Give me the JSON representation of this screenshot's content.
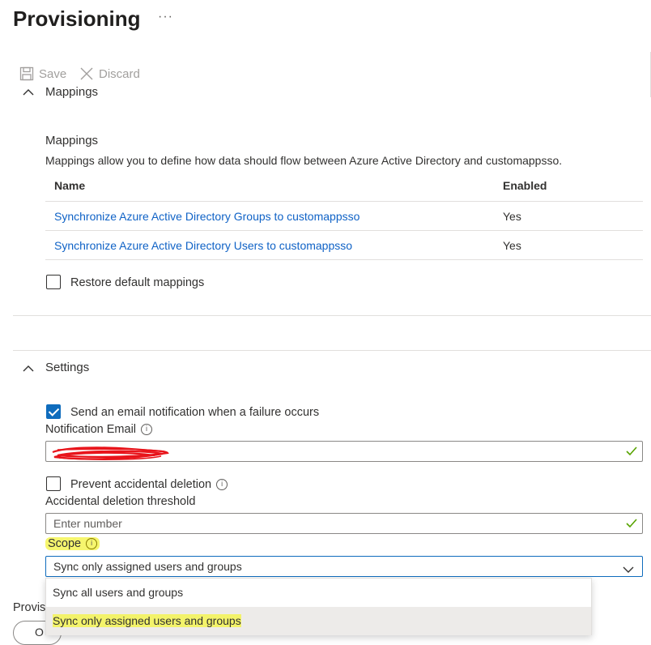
{
  "page": {
    "title": "Provisioning",
    "more": "···"
  },
  "toolbar": {
    "save_label": "Save",
    "discard_label": "Discard"
  },
  "mappings_section": {
    "header": "Mappings",
    "title": "Mappings",
    "description": "Mappings allow you to define how data should flow between Azure Active Directory and customappsso.",
    "columns": [
      "Name",
      "Enabled"
    ],
    "rows": [
      {
        "name": "Synchronize Azure Active Directory Groups to customappsso",
        "enabled": "Yes"
      },
      {
        "name": "Synchronize Azure Active Directory Users to customappsso",
        "enabled": "Yes"
      }
    ],
    "restore_label": "Restore default mappings"
  },
  "settings_section": {
    "header": "Settings",
    "email_notification_label": "Send an email notification when a failure occurs",
    "email_notification_checked": true,
    "notification_email_label": "Notification Email",
    "prevent_deletion_label": "Prevent accidental deletion",
    "prevent_deletion_checked": false,
    "threshold_label": "Accidental deletion threshold",
    "threshold_placeholder": "Enter number",
    "scope_label": "Scope",
    "scope_value": "Sync only assigned users and groups",
    "scope_options": [
      "Sync all users and groups",
      "Sync only assigned users and groups"
    ]
  },
  "footer": {
    "partial_label": "Provisi",
    "partial_button": "O"
  },
  "colors": {
    "accent": "#0f6cbd",
    "link": "#0f62c6",
    "highlight": "#f3f36a",
    "redaction": "#e8141b",
    "valid": "#57a300"
  }
}
